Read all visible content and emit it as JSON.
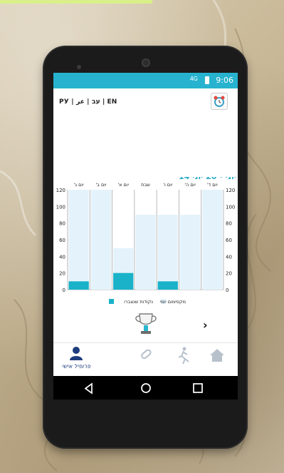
{
  "status_bar": {
    "time": "9:06",
    "signal_label": "4G"
  },
  "language_bar": {
    "text": "РУ | עב | عر | EN"
  },
  "chart_data": {
    "type": "bar",
    "title": "14 יוני - 20 יוני",
    "categories": [
      "יום ד'",
      "יום ה'",
      "יום ו'",
      "שבת",
      "יום א'",
      "יום ב'",
      "יום ג'"
    ],
    "series": [
      {
        "name": "מקסימום יומי",
        "values": [
          120,
          90,
          90,
          90,
          50,
          120,
          120
        ]
      },
      {
        "name": "נקודות שנצברו",
        "values": [
          0,
          0,
          10,
          0,
          20,
          0,
          10
        ]
      }
    ],
    "ylim": [
      0,
      120
    ],
    "yticks": [
      0,
      20,
      40,
      60,
      80,
      100,
      120
    ],
    "colors": {
      "max": "#e4f3fb",
      "points": "#19b2c9",
      "grid": "#a7a7a7"
    }
  },
  "bottom_nav": {
    "profile_label": "פרופיל אישי",
    "active_color": "#1e3d7d",
    "inactive_color": "#b7c1cc"
  }
}
